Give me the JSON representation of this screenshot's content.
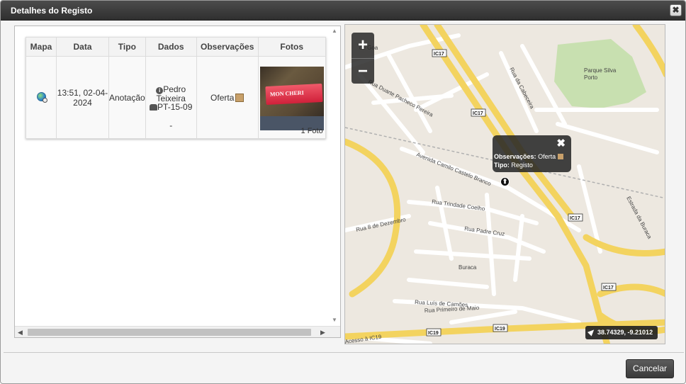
{
  "dialog": {
    "title": "Detalhes do Registo",
    "close_glyph": "✖",
    "cancel_label": "Cancelar"
  },
  "table": {
    "headers": [
      "Mapa",
      "Data",
      "Tipo",
      "Dados",
      "Observações",
      "Fotos"
    ],
    "row": {
      "map_icon": "globe-search-icon",
      "date": "13:51, 02-04-2024",
      "type": "Anotação",
      "dados_name": "Pedro Teixeira",
      "dados_plate": "PT-15-09",
      "dados_extra": "-",
      "observacoes": "Oferta",
      "photo_brand": "MON CHERI",
      "photo_count": "1 Foto"
    }
  },
  "map": {
    "zoom_in": "+",
    "zoom_out": "−",
    "popup": {
      "obs_label": "Observações:",
      "obs_value": "Oferta",
      "tipo_label": "Tipo:",
      "tipo_value": "Registo",
      "close_glyph": "✖"
    },
    "marker_glyph": "⬆",
    "coordinates": "38.74329, -9.21012",
    "labels": {
      "park": "Parque Silva",
      "park2": "Porto",
      "goa": "de Goa",
      "duarte": "Rua Duarte Pacheco Pereira",
      "cabeceira": "Rua da Cabeceira",
      "camilo": "Avenida Camilo Castelo Branco",
      "trindade": "Rua Trindade Coelho",
      "dezembro": "Rua 8 de Dezembro",
      "padre": "Rua Padre Cruz",
      "buraca": "Buraca",
      "estrada": "Estrada da Buraca",
      "camoes": "Rua Luís de Camões",
      "maio": "Rua Primeiro de Maio",
      "acesso": "Acesso à IC19"
    },
    "badges": {
      "ic17": "IC17",
      "ic19": "IC19"
    }
  }
}
